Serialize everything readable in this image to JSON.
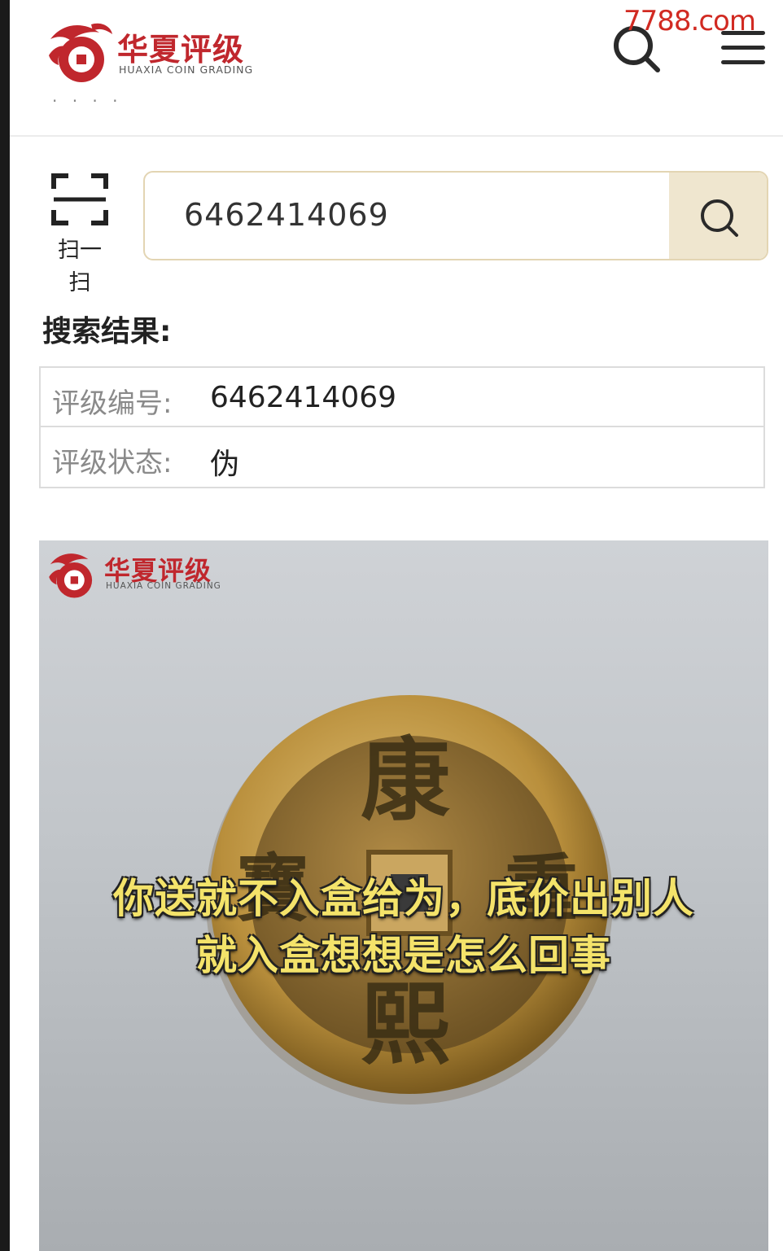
{
  "watermark": {
    "prefix": "7788",
    "suffix": ".com",
    "color": "#d12a22"
  },
  "brand": {
    "name_cn": "华夏评级",
    "name_en": "HUAXIA COIN GRADING",
    "color": "#c0272d"
  },
  "header": {
    "search_icon": "search-icon",
    "menu_icon": "menu-icon",
    "cut_text": "· ·  ·  ·"
  },
  "scan": {
    "label": "扫一扫",
    "icon": "scan-icon"
  },
  "search": {
    "value": "6462414069",
    "button_icon": "search-icon"
  },
  "result": {
    "title": "搜索结果:",
    "rows": [
      {
        "key": "评级编号:",
        "value": "6462414069"
      },
      {
        "key": "评级状态:",
        "value": "伪"
      }
    ]
  },
  "photo": {
    "coin_chars": {
      "top": "康",
      "bottom": "熙",
      "left": "寶",
      "right": "重"
    },
    "caption_line1": "你送就不入盒给为，底价出别人",
    "caption_line2": "就入盒想想是怎么回事"
  }
}
